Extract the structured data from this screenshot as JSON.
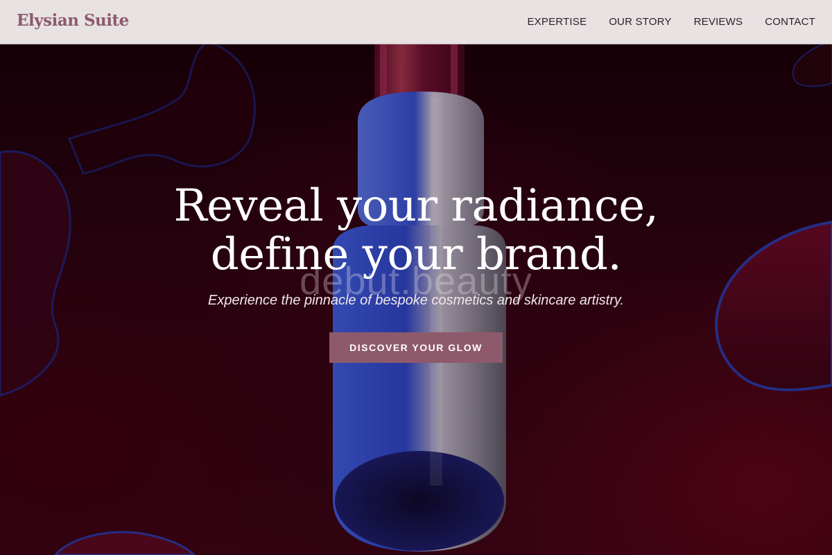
{
  "brand": {
    "name": "Elysian Suite",
    "color": "#8e5a6b"
  },
  "nav": {
    "items": [
      {
        "label": "EXPERTISE"
      },
      {
        "label": "OUR STORY"
      },
      {
        "label": "REVIEWS"
      },
      {
        "label": "CONTACT"
      }
    ]
  },
  "hero": {
    "title_line1": "Reveal your radiance,",
    "title_line2": "define your brand.",
    "watermark": "debut.beauty",
    "subtitle": "Experience the pinnacle of bespoke cosmetics and skincare artistry.",
    "cta_label": "DISCOVER YOUR GLOW",
    "cta_color": "#8e5a6b"
  }
}
